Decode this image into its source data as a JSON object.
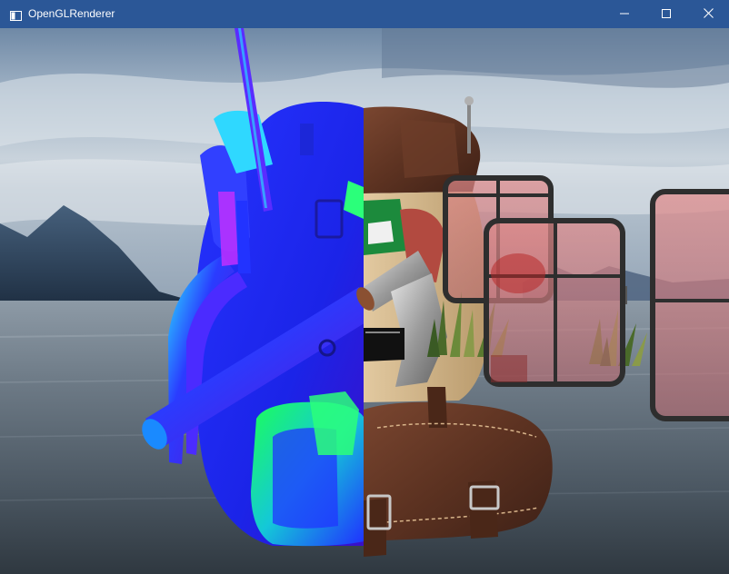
{
  "window": {
    "title": "OpenGLRenderer",
    "icon": "app-window-icon",
    "controls": {
      "minimize_icon": "minimize-icon",
      "maximize_icon": "maximize-icon",
      "close_icon": "close-icon"
    }
  },
  "scene": {
    "description_icons": [
      "skybox",
      "backpack-model",
      "grass-sprites",
      "window-panes"
    ],
    "colors": {
      "titlebar": "#2b5797",
      "normal_blue": "#1f2cff",
      "normal_green": "#18ff6a",
      "normal_magenta": "#c232ff",
      "leather": "#6b3a26",
      "canvas": "#d6b98e",
      "window_tint": "#d87878",
      "frame": "#2e2e2e"
    }
  }
}
